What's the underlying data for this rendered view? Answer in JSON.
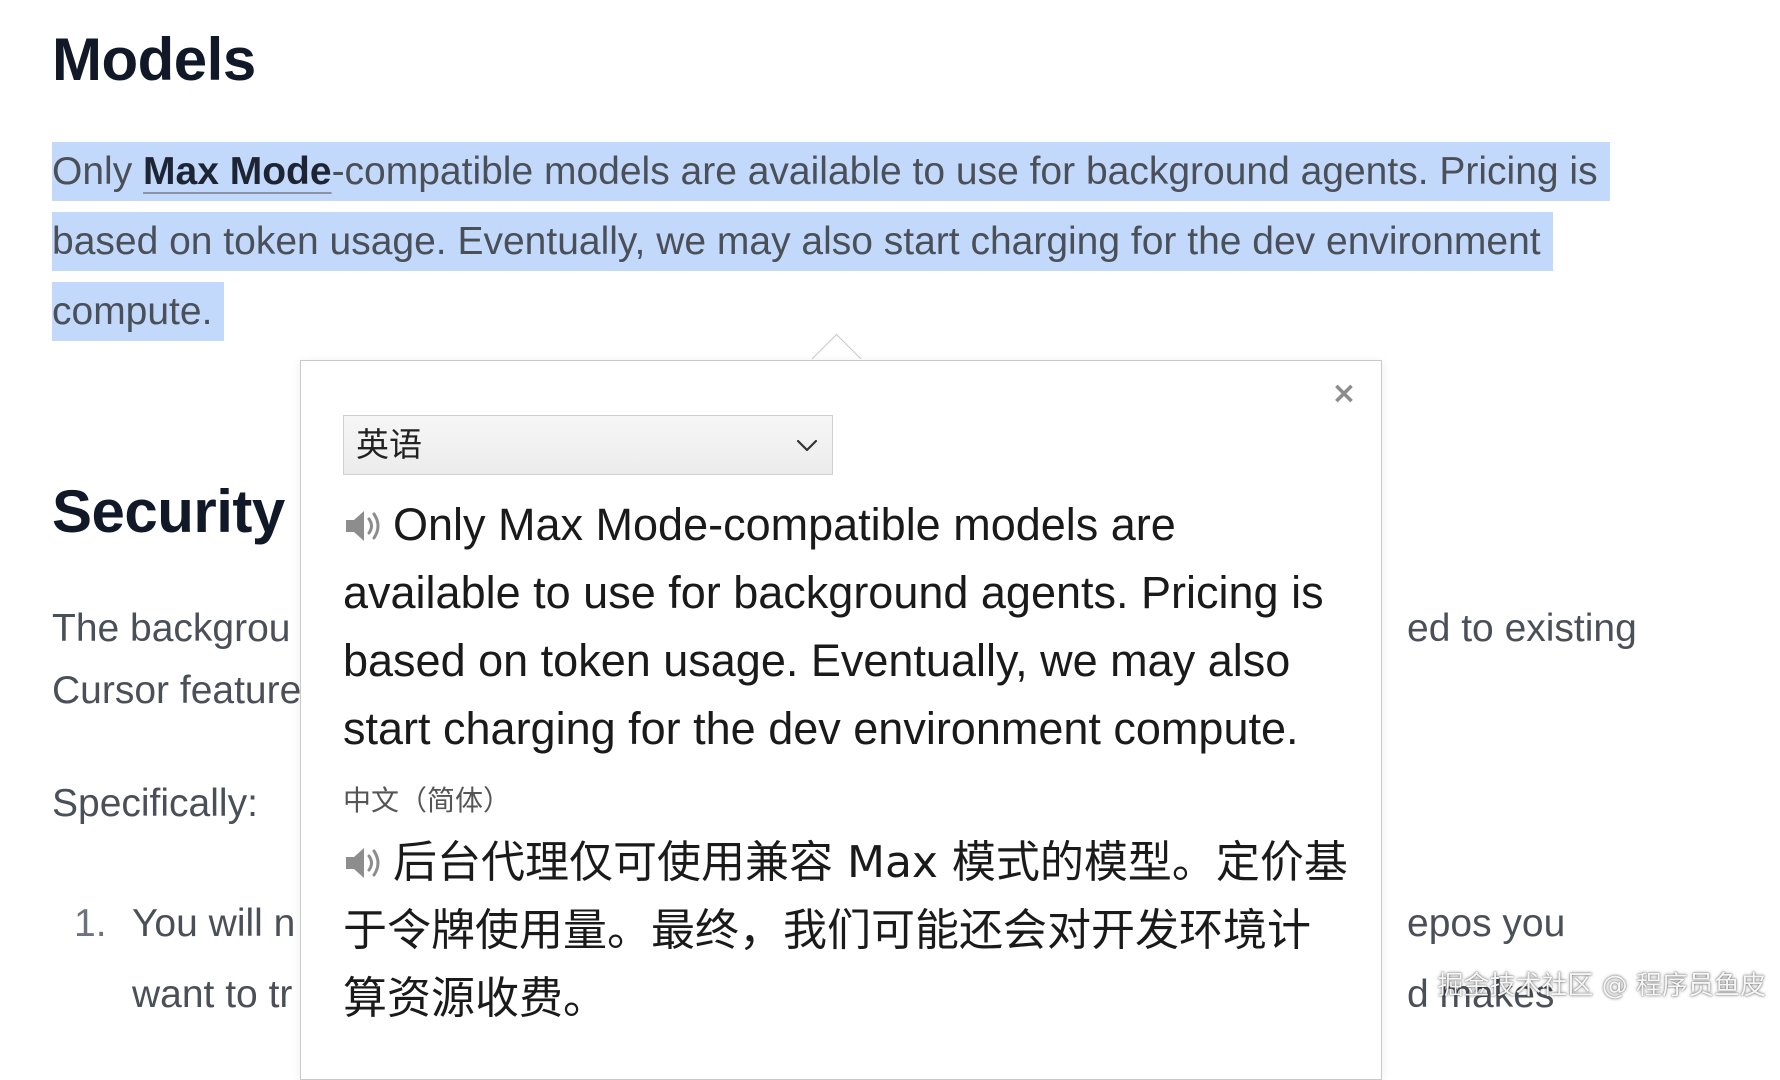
{
  "doc": {
    "models_heading": "Models",
    "models_para": {
      "prefix": "Only ",
      "link": "Max Mode",
      "suffix": "-compatible models are available to use for background agents. Pricing is based on token usage. Eventually, we may also start charging for the dev environment compute."
    },
    "security_heading": "Security",
    "security_line1_left": "The backgrou",
    "security_line1_right": "ed to existing",
    "security_line2_left": "Cursor feature",
    "specifically": "Specifically:",
    "list_item1": {
      "number": "1.",
      "line1_left": "You will n",
      "line1_right": "epos you",
      "line2_left": "want to tr",
      "line2_right": "d makes"
    }
  },
  "popup": {
    "close_symbol": "×",
    "language_select": {
      "selected": "英语"
    },
    "source_text": "Only Max Mode-compatible models are available to use for background agents. Pricing is based on token usage. Eventually, we may also start charging for the dev environment compute.",
    "target_language_label": "中文（简体）",
    "target_text": "后台代理仅可使用兼容 Max 模式的模型。定价基于令牌使用量。最终，我们可能还会对开发环境计算资源收费。"
  },
  "watermark": "掘金技术社区 @ 程序员鱼皮",
  "colors": {
    "selection": "#c2d9fb",
    "heading": "#111827",
    "body_text": "#4b5058"
  }
}
